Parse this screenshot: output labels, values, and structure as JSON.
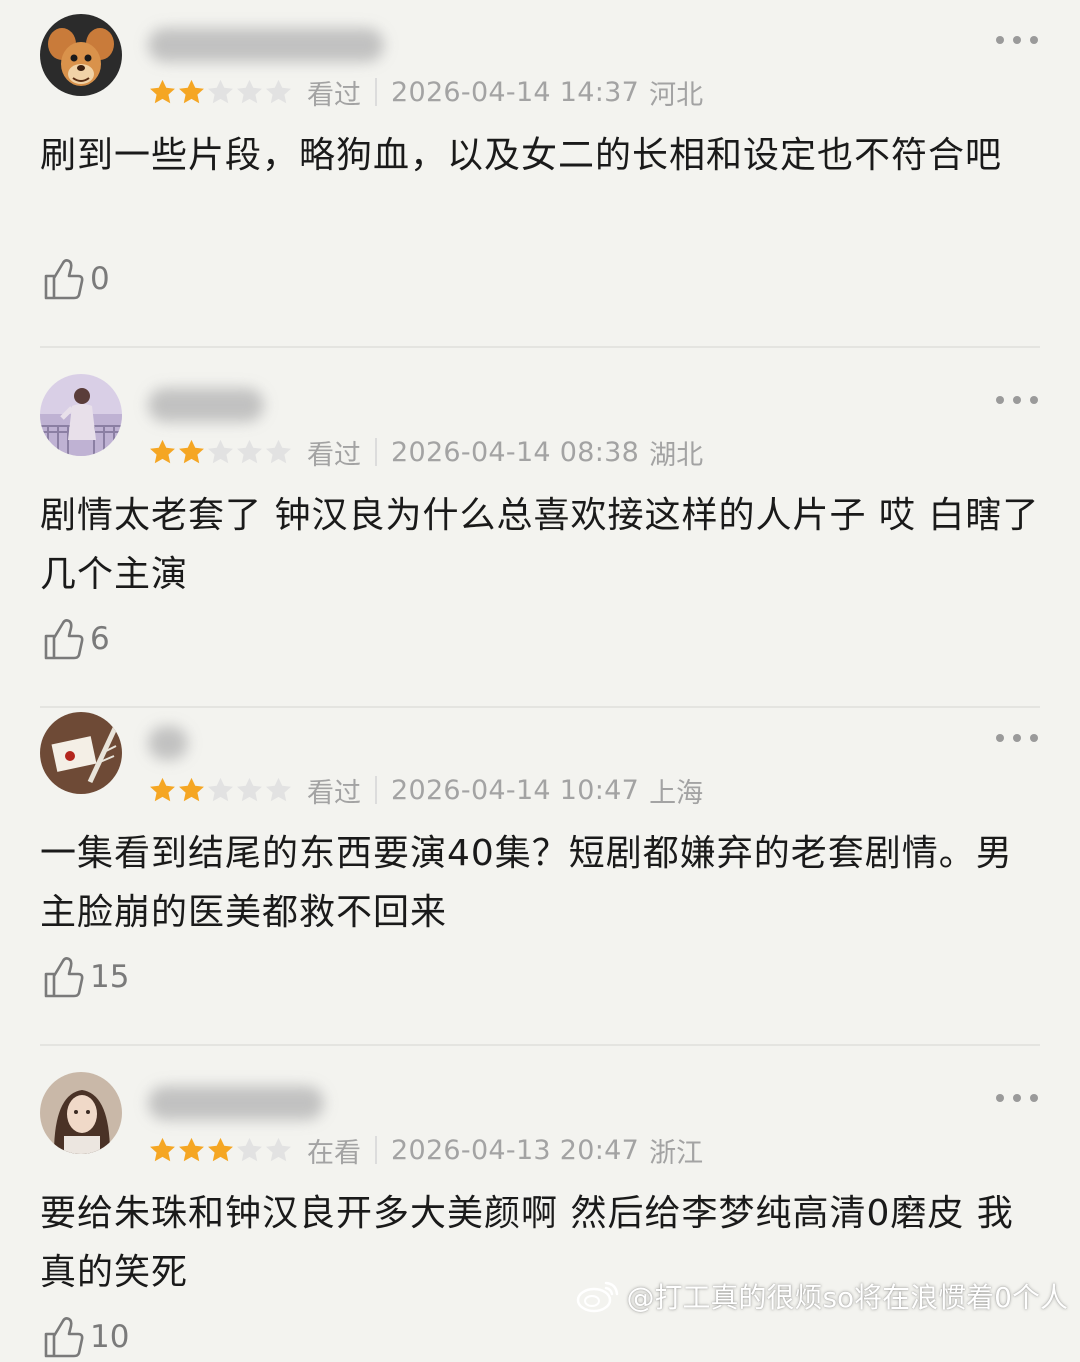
{
  "reviews": [
    {
      "avatar": "cartoon-mouse-avatar",
      "rating": 2,
      "status": "看过",
      "datetime": "2026-04-14 14:37",
      "region": "河北",
      "text": "刷到一些片段，略狗血，以及女二的长相和设定也不符合吧",
      "likes": "0"
    },
    {
      "avatar": "woman-balcony-avatar",
      "rating": 2,
      "status": "看过",
      "datetime": "2026-04-14 08:38",
      "region": "湖北",
      "text": "剧情太老套了 钟汉良为什么总喜欢接这样的人片子 哎 白瞎了几个主演",
      "likes": "6"
    },
    {
      "avatar": "envelope-quill-avatar",
      "rating": 2,
      "status": "看过",
      "datetime": "2026-04-14 10:47",
      "region": "上海",
      "text": "一集看到结尾的东西要演40集？短剧都嫌弃的老套剧情。男主脸崩的医美都救不回来",
      "likes": "15"
    },
    {
      "avatar": "girl-portrait-avatar",
      "rating": 3,
      "status": "在看",
      "datetime": "2026-04-13 20:47",
      "region": "浙江",
      "text": "要给朱珠和钟汉良开多大美颜啊 然后给李梦纯高清0磨皮 我真的笑死",
      "likes": "10"
    }
  ],
  "colors": {
    "star_filled": "#f5a623",
    "star_empty": "#e2e2e2",
    "background": "#f3f3ef"
  },
  "watermark": {
    "icon": "weibo-icon",
    "text": "@打工真的很烦so将在浪惯着0个人"
  }
}
